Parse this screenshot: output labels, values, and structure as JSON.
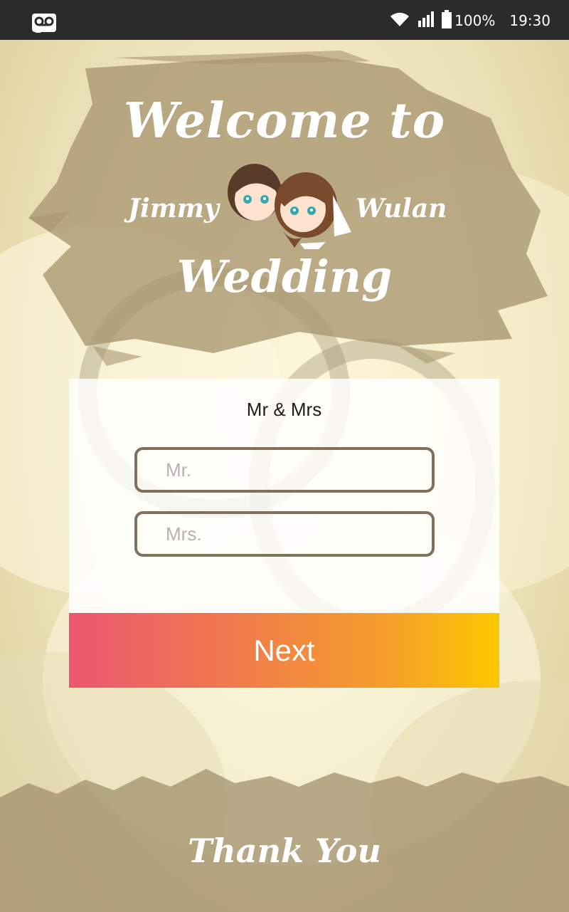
{
  "status_bar": {
    "left_icon": "voicemail-icon",
    "wifi_icon": "wifi-icon",
    "signal_icon": "signal-icon",
    "battery_icon": "battery-icon",
    "battery": "100%",
    "time": "19:30"
  },
  "header": {
    "welcome": "Welcome to",
    "groom": "Jimmy",
    "bride": "Wulan",
    "wedding": "Wedding"
  },
  "form": {
    "title": "Mr & Mrs",
    "mr_placeholder": "Mr.",
    "mrs_placeholder": "Mrs.",
    "mr_value": "",
    "mrs_value": "",
    "next_label": "Next"
  },
  "footer": {
    "thank_you": "Thank You"
  },
  "colors": {
    "status_bar": "#2b2b2b",
    "brush": "#b3a27e",
    "field_border": "#80705c",
    "gradient_start": "#ec5672",
    "gradient_end": "#fdc700"
  }
}
